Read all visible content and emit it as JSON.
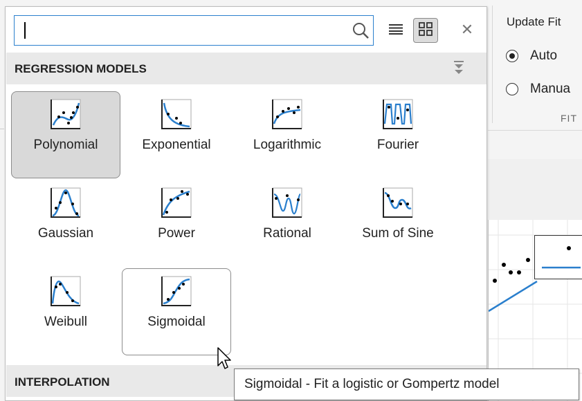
{
  "search": {
    "value": "",
    "placeholder": ""
  },
  "view_buttons": {
    "list_icon": "list-view-icon",
    "grid_icon": "grid-view-icon",
    "close_icon": "close-icon"
  },
  "sections": {
    "regression_label": "REGRESSION MODELS",
    "interpolation_label": "INTERPOLATION"
  },
  "models": [
    {
      "label": "Polynomial",
      "icon": "polynomial-icon",
      "state": "selected"
    },
    {
      "label": "Exponential",
      "icon": "exponential-icon"
    },
    {
      "label": "Logarithmic",
      "icon": "logarithmic-icon"
    },
    {
      "label": "Fourier",
      "icon": "fourier-icon"
    },
    {
      "label": "Gaussian",
      "icon": "gaussian-icon"
    },
    {
      "label": "Power",
      "icon": "power-icon"
    },
    {
      "label": "Rational",
      "icon": "rational-icon"
    },
    {
      "label": "Sum of Sine",
      "icon": "sum-of-sine-icon"
    },
    {
      "label": "Weibull",
      "icon": "weibull-icon"
    },
    {
      "label": "Sigmoidal",
      "icon": "sigmoidal-icon",
      "state": "hover"
    }
  ],
  "ribbon": {
    "update_fit_label": "Update Fit",
    "auto_label": "Auto",
    "manual_label": "Manua",
    "group_label": "FIT",
    "auto_selected": true
  },
  "tooltip": {
    "text": "Sigmoidal - Fit a logistic or Gompertz model"
  },
  "colors": {
    "accent": "#2a7fcd",
    "fit_line": "#2a7fcd",
    "selected_tile": "#d9d9d9"
  }
}
